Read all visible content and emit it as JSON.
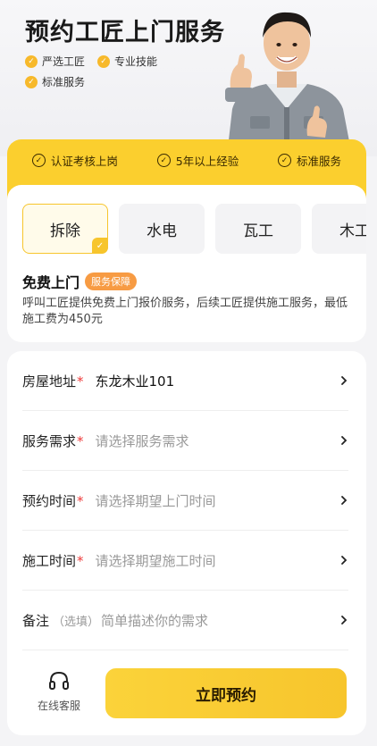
{
  "hero": {
    "title": "预约工匠上门服务",
    "badges": [
      "严选工匠",
      "专业技能",
      "标准服务"
    ]
  },
  "band": {
    "items": [
      "认证考核上岗",
      "5年以上经验",
      "标准服务"
    ]
  },
  "tabs": [
    {
      "label": "拆除",
      "selected": true
    },
    {
      "label": "水电",
      "selected": false
    },
    {
      "label": "瓦工",
      "selected": false
    },
    {
      "label": "木工",
      "selected": false
    }
  ],
  "service_info": {
    "title": "免费上门",
    "tag": "服务保障",
    "description": "呼叫工匠提供免费上门报价服务，后续工匠提供施工服务，最低施工费为450元"
  },
  "form": {
    "address": {
      "label": "房屋地址",
      "required": "*",
      "value": "东龙木业101"
    },
    "need": {
      "label": "服务需求",
      "required": "*",
      "placeholder": "请选择服务需求"
    },
    "appointment": {
      "label": "预约时间",
      "required": "*",
      "placeholder": "请选择期望上门时间"
    },
    "construction": {
      "label": "施工时间",
      "required": "*",
      "placeholder": "请选择期望施工时间"
    },
    "note": {
      "label": "备注",
      "optional": "（选填）",
      "placeholder": "简单描述你的需求"
    }
  },
  "bottom": {
    "customer_service_label": "在线客服",
    "book_button": "立即预约"
  },
  "colors": {
    "accent_yellow": "#fbcf2e",
    "required_red": "#ee3b3b",
    "tag_orange": "#f79b43"
  },
  "icons": {
    "check": "check-icon",
    "chevron": "chevron-right-icon",
    "headset": "headset-icon"
  }
}
